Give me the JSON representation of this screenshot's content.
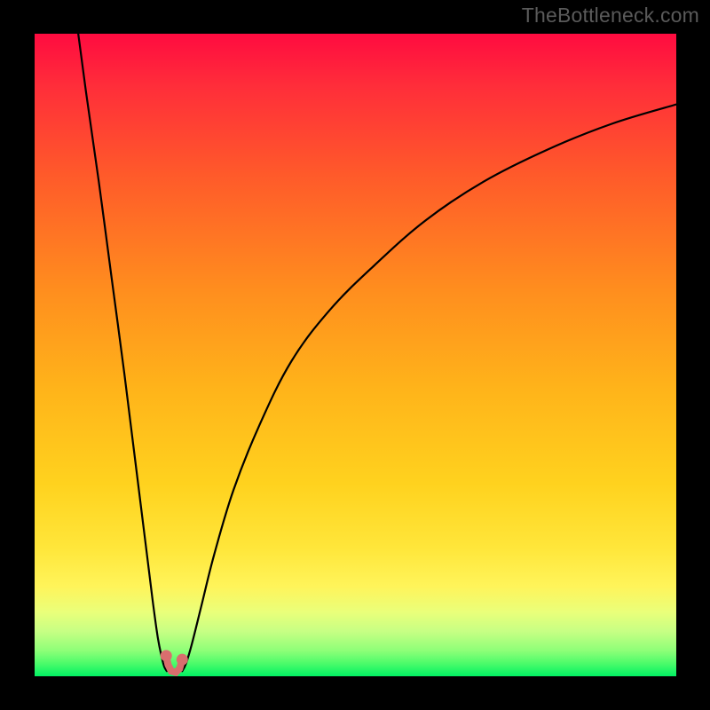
{
  "watermark": "TheBottleneck.com",
  "chart_data": {
    "type": "line",
    "title": "",
    "xlabel": "",
    "ylabel": "",
    "xlim": [
      0,
      100
    ],
    "ylim": [
      0,
      100
    ],
    "grid": false,
    "legend": false,
    "background": "red-yellow-green vertical gradient",
    "series": [
      {
        "name": "left-branch",
        "x": [
          6.8,
          8,
          10,
          12,
          14,
          16,
          17.5,
          18.5,
          19.2,
          19.8,
          20.2,
          20.6
        ],
        "y": [
          100,
          91,
          77,
          62,
          47,
          31,
          19,
          11,
          6,
          3,
          1.5,
          0.8
        ]
      },
      {
        "name": "right-branch",
        "x": [
          23.0,
          23.6,
          24.5,
          26,
          28,
          31,
          35,
          40,
          46,
          53,
          61,
          70,
          80,
          90,
          100
        ],
        "y": [
          0.8,
          2,
          5,
          11,
          19,
          29,
          39,
          49,
          57,
          64,
          71,
          77,
          82,
          86,
          89
        ]
      }
    ],
    "markers": {
      "name": "bottleneck-region",
      "color": "#d96e6e",
      "points": [
        {
          "x": 20.5,
          "y": 3.2
        },
        {
          "x": 20.8,
          "y": 1.8
        },
        {
          "x": 21.3,
          "y": 0.8
        },
        {
          "x": 22.0,
          "y": 0.6
        },
        {
          "x": 22.6,
          "y": 1.2
        },
        {
          "x": 23.0,
          "y": 2.6
        }
      ]
    }
  }
}
